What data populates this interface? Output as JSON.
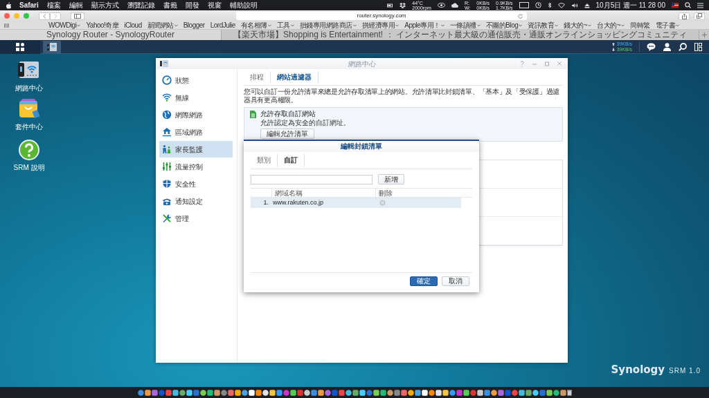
{
  "menubar": {
    "app": "Safari",
    "menus": [
      "檔案",
      "編輯",
      "顯示方式",
      "瀏覽記錄",
      "書籤",
      "開發",
      "視窗",
      "輔助說明"
    ],
    "status": {
      "temp": "44°C",
      "fan": "2000rpm",
      "disk_labels": [
        "R:",
        "W:"
      ],
      "disk_rates": [
        "0KB/s",
        "0KB/s"
      ],
      "net_rates": [
        "0.9KB/s",
        "1.7KB/s"
      ],
      "clock": "10月5日 週一 11 28 00"
    }
  },
  "browser": {
    "address": "router.synology.com",
    "bookmarks": [
      {
        "label": "WOWDigi",
        "menu": true
      },
      {
        "label": "Yahoo!奇摩",
        "menu": false
      },
      {
        "label": "iCloud",
        "menu": false
      },
      {
        "label": "新聞網站",
        "menu": true
      },
      {
        "label": "Blogger",
        "menu": false
      },
      {
        "label": "LordJulie",
        "menu": false
      },
      {
        "label": "有名相簿",
        "menu": true
      },
      {
        "label": "工具",
        "menu": true
      },
      {
        "label": "損錢專用網路商店",
        "menu": true
      },
      {
        "label": "拼經濟專用",
        "menu": true
      },
      {
        "label": "Apple專用！",
        "menu": true
      },
      {
        "label": "一條讀禮",
        "menu": true
      },
      {
        "label": "不團的Blog",
        "menu": true
      },
      {
        "label": "資訊教育",
        "menu": true
      },
      {
        "label": "錢大的~",
        "menu": true
      },
      {
        "label": "台大的~",
        "menu": true
      },
      {
        "label": "簡轉繁",
        "menu": false
      },
      {
        "label": "電子書",
        "menu": true
      }
    ],
    "tabs": [
      {
        "title": "Synology Router - SynologyRouter",
        "selected": true
      },
      {
        "title": "【楽天市場】Shopping is Entertainment! ： インターネット最大級の通信販売・通販オンラインショッピングコミュニティ",
        "selected": false
      }
    ]
  },
  "taskbar": {
    "rates": [
      "39KB/s",
      "39KB/s"
    ]
  },
  "desktop_icons": [
    {
      "label": "網路中心"
    },
    {
      "label": "套件中心"
    },
    {
      "label": "SRM 說明"
    }
  ],
  "window": {
    "title": "網路中心",
    "sidebar": [
      {
        "label": "狀態",
        "selected": false
      },
      {
        "label": "無線",
        "selected": false
      },
      {
        "label": "網際網路",
        "selected": false
      },
      {
        "label": "區域網路",
        "selected": false
      },
      {
        "label": "家長監護",
        "selected": true
      },
      {
        "label": "流量控制",
        "selected": false
      },
      {
        "label": "安全性",
        "selected": false
      },
      {
        "label": "通知設定",
        "selected": false
      },
      {
        "label": "管理",
        "selected": false
      }
    ],
    "tabs": [
      {
        "label": "排程",
        "selected": false
      },
      {
        "label": "網站過濾器",
        "selected": true
      }
    ],
    "description": "您可以自訂一份允許清單來總是允許存取清單上的網站。允許清單比封鎖清單、「基本」及「受保護」過濾器具有更高權限。",
    "panel": {
      "title": "允許存取自訂網站",
      "text": "允許認定為安全的自訂網址。",
      "button": "編輯允許清單"
    }
  },
  "dialog": {
    "title": "編輯封鎖清單",
    "tabs": [
      {
        "label": "類別",
        "selected": false
      },
      {
        "label": "自訂",
        "selected": true
      }
    ],
    "add_button": "新增",
    "columns": [
      "網域名稱",
      "刪除"
    ],
    "rows": [
      {
        "index": "1.",
        "domain": "www.rakuten.co.jp",
        "selected": true
      }
    ],
    "buttons": [
      {
        "label": "確定",
        "kind": "primary"
      },
      {
        "label": "取消",
        "kind": "secondary"
      }
    ]
  },
  "branding": {
    "logo": "Synology",
    "product": "SRM 1.0"
  }
}
